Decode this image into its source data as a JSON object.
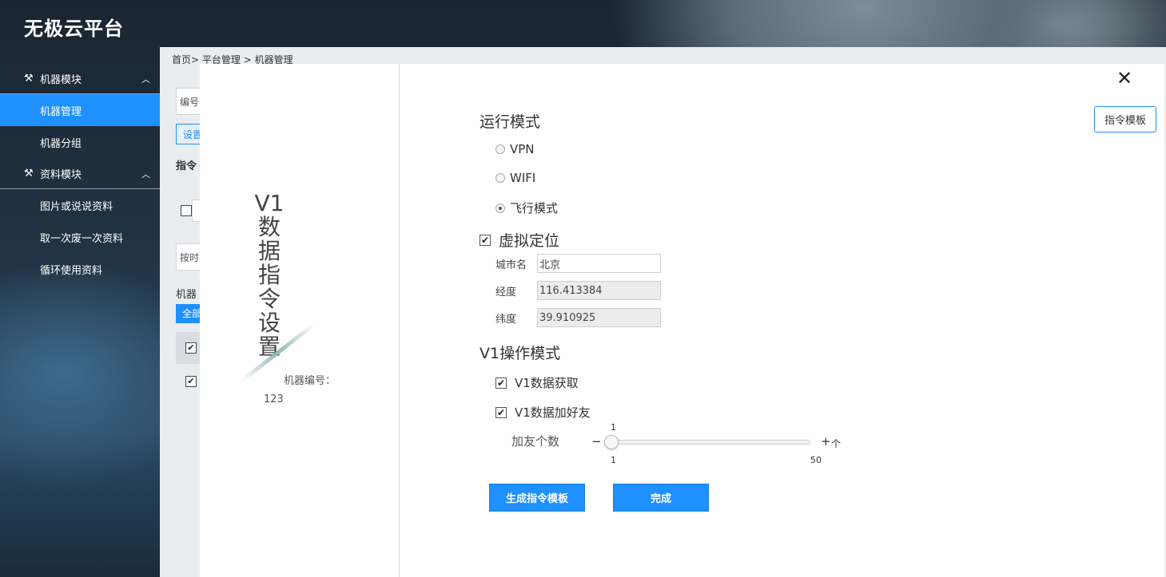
{
  "app": {
    "title": "无极云平台"
  },
  "sidebar": {
    "groups": [
      {
        "label": "机器模块",
        "icon": "tools-icon",
        "items": [
          {
            "label": "机器管理",
            "active": true
          },
          {
            "label": "机器分组",
            "active": false
          }
        ]
      },
      {
        "label": "资料模块",
        "icon": "tools-icon",
        "items": [
          {
            "label": "图片或说说资料"
          },
          {
            "label": "取一次废一次资料"
          },
          {
            "label": "循环使用资料"
          }
        ]
      }
    ]
  },
  "breadcrumb": {
    "home": "首页",
    "sep1": ">",
    "level1": "平台管理",
    "sep2": ">",
    "level2": "机器管理"
  },
  "background": {
    "field1": "编号",
    "btn1": "设置",
    "label1": "指令",
    "field2": "按时",
    "label2": "机器",
    "btn2": "全部"
  },
  "modal": {
    "vertical_title": [
      "V1",
      "数",
      "据",
      "指",
      "令",
      "设",
      "置"
    ],
    "machine_label": "机器编号：",
    "machine_id": "123",
    "close_symbol": "✕",
    "template_button": "指令模板",
    "run_mode": {
      "title": "运行模式",
      "options": [
        {
          "label": "VPN",
          "selected": false
        },
        {
          "label": "WIFI",
          "selected": false
        },
        {
          "label": "飞行模式",
          "selected": true
        }
      ]
    },
    "virtual_location": {
      "label": "虚拟定位",
      "checked": true,
      "city_label": "城市名",
      "city_value": "北京",
      "lng_label": "经度",
      "lng_value": "116.413384",
      "lat_label": "纬度",
      "lat_value": "39.910925"
    },
    "v1_mode": {
      "title": "V1操作模式",
      "options": [
        {
          "label": "V1数据获取",
          "checked": true
        },
        {
          "label": "V1数据加好友",
          "checked": true
        }
      ],
      "friend_count_label": "加友个数",
      "minus": "−",
      "plus": "+",
      "unit": "个",
      "slider_value": "1",
      "slider_min": "1",
      "slider_max": "50"
    },
    "buttons": {
      "generate": "生成指令模板",
      "done": "完成"
    }
  },
  "colors": {
    "accent": "#1e90ff",
    "sidebar_active": "#1e90ff"
  }
}
